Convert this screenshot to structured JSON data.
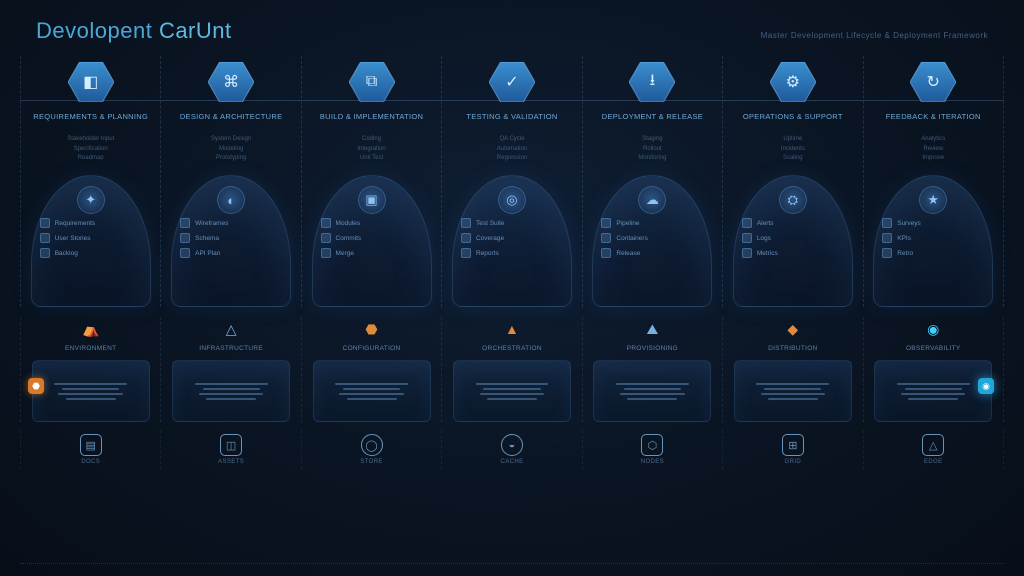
{
  "header": {
    "title_a": "Devolopent",
    "title_b": "CarUnt",
    "subtitle": "Master Development Lifecycle & Deployment Framework"
  },
  "columns": [
    {
      "title": "REQUIREMENTS & PLANNING",
      "sub": [
        "Stakeholder Input",
        "Specification",
        "Roadmap"
      ],
      "hex_glyph": "◧",
      "dome_glyph": "✦",
      "dome_items": [
        "Requirements",
        "User Stories",
        "Backlog"
      ]
    },
    {
      "title": "DESIGN & ARCHITECTURE",
      "sub": [
        "System Design",
        "Modeling",
        "Prototyping"
      ],
      "hex_glyph": "⌘",
      "dome_glyph": "◐",
      "dome_items": [
        "Wireframes",
        "Schema",
        "API Plan"
      ]
    },
    {
      "title": "BUILD & IMPLEMENTATION",
      "sub": [
        "Coding",
        "Integration",
        "Unit Test"
      ],
      "hex_glyph": "⧉",
      "dome_glyph": "▣",
      "dome_items": [
        "Modules",
        "Commits",
        "Merge"
      ]
    },
    {
      "title": "TESTING & VALIDATION",
      "sub": [
        "QA Cycle",
        "Automation",
        "Regression"
      ],
      "hex_glyph": "✓",
      "dome_glyph": "◎",
      "dome_items": [
        "Test Suite",
        "Coverage",
        "Reports"
      ]
    },
    {
      "title": "DEPLOYMENT & RELEASE",
      "sub": [
        "Staging",
        "Rollout",
        "Monitoring"
      ],
      "hex_glyph": "⭳",
      "dome_glyph": "☁",
      "dome_items": [
        "Pipeline",
        "Containers",
        "Release"
      ]
    },
    {
      "title": "OPERATIONS & SUPPORT",
      "sub": [
        "Uptime",
        "Incidents",
        "Scaling"
      ],
      "hex_glyph": "⚙",
      "dome_glyph": "⛭",
      "dome_items": [
        "Alerts",
        "Logs",
        "Metrics"
      ]
    },
    {
      "title": "FEEDBACK & ITERATION",
      "sub": [
        "Analytics",
        "Review",
        "Improve"
      ],
      "hex_glyph": "↻",
      "dome_glyph": "★",
      "dome_items": [
        "Surveys",
        "KPIs",
        "Retro"
      ]
    }
  ],
  "row2": [
    {
      "glyph": "⛺",
      "style": "",
      "label": "ENVIRONMENT"
    },
    {
      "glyph": "△",
      "style": "",
      "label": "INFRASTRUCTURE"
    },
    {
      "glyph": "⬣",
      "style": "orange",
      "label": "CONFIGURATION"
    },
    {
      "glyph": "▲",
      "style": "orange",
      "label": "ORCHESTRATION"
    },
    {
      "glyph": "⛰",
      "style": "",
      "label": "PROVISIONING"
    },
    {
      "glyph": "◆",
      "style": "orange",
      "label": "DISTRIBUTION"
    },
    {
      "glyph": "◉",
      "style": "cyan",
      "label": "OBSERVABILITY"
    }
  ],
  "footer": [
    {
      "glyph": "▤",
      "shape": "",
      "label": "DOCS"
    },
    {
      "glyph": "◫",
      "shape": "",
      "label": "ASSETS"
    },
    {
      "glyph": "◯",
      "shape": "round",
      "label": "STORE"
    },
    {
      "glyph": "◒",
      "shape": "round",
      "label": "CACHE"
    },
    {
      "glyph": "⬡",
      "shape": "",
      "label": "NODES"
    },
    {
      "glyph": "⊞",
      "shape": "",
      "label": "GRID"
    },
    {
      "glyph": "△",
      "shape": "",
      "label": "EDGE"
    }
  ]
}
